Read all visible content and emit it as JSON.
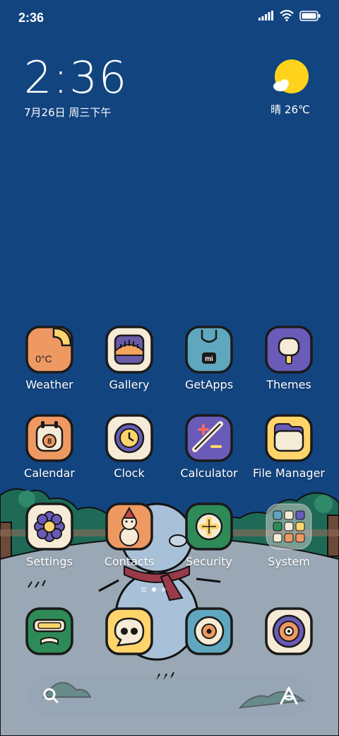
{
  "status_bar": {
    "time": "2:36",
    "icons": [
      "signal-icon",
      "wifi-icon",
      "battery-icon"
    ]
  },
  "clock_widget": {
    "time": "2:36",
    "date": "7月26日 周三下午"
  },
  "weather_widget": {
    "icon": "sun-icon",
    "text": "晴 26℃"
  },
  "apps": [
    {
      "label": "Weather",
      "icon": "weather-icon",
      "icon_text": "0°C"
    },
    {
      "label": "Gallery",
      "icon": "gallery-icon"
    },
    {
      "label": "GetApps",
      "icon": "getapps-icon",
      "icon_text": "mi"
    },
    {
      "label": "Themes",
      "icon": "themes-icon"
    },
    {
      "label": "Calendar",
      "icon": "calendar-icon",
      "icon_text": "8"
    },
    {
      "label": "Clock",
      "icon": "clock-icon"
    },
    {
      "label": "Calculator",
      "icon": "calculator-icon"
    },
    {
      "label": "File Manager",
      "icon": "file-manager-icon"
    },
    {
      "label": "Settings",
      "icon": "settings-icon"
    },
    {
      "label": "Contacts",
      "icon": "contacts-icon"
    },
    {
      "label": "Security",
      "icon": "security-icon"
    },
    {
      "label": "System",
      "icon": "folder-icon"
    }
  ],
  "page_indicator": {
    "pages": 2,
    "current": 1
  },
  "dock": [
    {
      "icon": "browser-icon"
    },
    {
      "icon": "messages-icon"
    },
    {
      "icon": "camera-icon"
    },
    {
      "icon": "music-icon"
    }
  ],
  "search_bar": {
    "left_icon": "search-icon",
    "right_icon": "assistant-icon"
  },
  "colors": {
    "background": "#124480",
    "sun": "#FFD21C",
    "icon_outline": "#1a1a1a",
    "ground": "#9aa7b4"
  }
}
